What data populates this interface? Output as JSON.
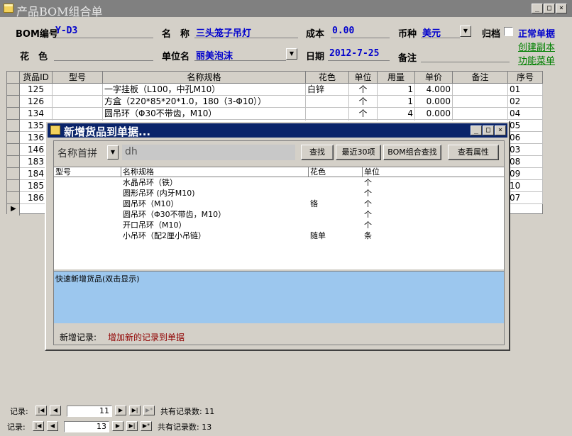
{
  "window": {
    "title": "产品BOM组合单"
  },
  "form": {
    "bom_no_label": "BOM编号",
    "bom_no": "Y-D3",
    "name_label": "名　称",
    "name": "三头笼子吊灯",
    "cost_label": "成本",
    "cost": "0.00",
    "currency_label": "币种",
    "currency": "美元",
    "archive_label": "归档",
    "status": "正常单据",
    "color_label": "花　色",
    "color": "",
    "unit_label": "单位名",
    "unit": "丽美泡沫",
    "date_label": "日期",
    "date": "2012-7-25",
    "remark_label": "备注",
    "remark": "",
    "create_copy": "创建副本",
    "function_menu": "功能菜单"
  },
  "grid": {
    "columns": [
      "货品ID",
      "型号",
      "名称规格",
      "花色",
      "单位",
      "用量",
      "单价",
      "备注",
      "序号"
    ],
    "rows": [
      {
        "id": "125",
        "model": "",
        "name": "一字挂板（L100，中孔M10）",
        "color": "白锌",
        "unit": "个",
        "qty": "1",
        "price": "4.000",
        "remark": "",
        "seq": "01"
      },
      {
        "id": "126",
        "model": "",
        "name": "方盒（220*85*20*1.0，180（3-Φ10））",
        "color": "",
        "unit": "个",
        "qty": "1",
        "price": "0.000",
        "remark": "",
        "seq": "02"
      },
      {
        "id": "134",
        "model": "",
        "name": "圆吊环（Φ30不带齿，M10）",
        "color": "",
        "unit": "个",
        "qty": "4",
        "price": "0.000",
        "remark": "",
        "seq": "04"
      },
      {
        "id": "135",
        "model": "",
        "name": "",
        "color": "",
        "unit": "",
        "qty": "",
        "price": "",
        "remark": "",
        "seq": "05"
      },
      {
        "id": "136",
        "model": "",
        "name": "",
        "color": "",
        "unit": "",
        "qty": "",
        "price": "",
        "remark": "",
        "seq": "06"
      },
      {
        "id": "146",
        "model": "",
        "name": "",
        "color": "",
        "unit": "",
        "qty": "",
        "price": "",
        "remark": "",
        "seq": "03"
      },
      {
        "id": "183",
        "model": "",
        "name": "",
        "color": "",
        "unit": "",
        "qty": "",
        "price": "",
        "remark": "",
        "seq": "08"
      },
      {
        "id": "184",
        "model": "",
        "name": "",
        "color": "",
        "unit": "",
        "qty": "",
        "price": "",
        "remark": "",
        "seq": "09"
      },
      {
        "id": "185",
        "model": "",
        "name": "",
        "color": "",
        "unit": "",
        "qty": "",
        "price": "",
        "remark": "",
        "seq": "10"
      },
      {
        "id": "186",
        "model": "",
        "name": "",
        "color": "",
        "unit": "",
        "qty": "",
        "price": "",
        "remark": "",
        "seq": "07"
      }
    ]
  },
  "dialog": {
    "title": "新增货品到单据...",
    "search_label": "名称首拼",
    "search_value": "dh",
    "btn_search": "查找",
    "btn_recent": "最近30项",
    "btn_bom": "BOM组合查找",
    "btn_props": "查看属性",
    "columns": [
      "型号",
      "名称规格",
      "花色",
      "单位"
    ],
    "products": [
      {
        "model": "",
        "name": "水晶吊环（铁）",
        "color": "",
        "unit": "个"
      },
      {
        "model": "",
        "name": "圆形吊环 (内牙M10)",
        "color": "",
        "unit": "个"
      },
      {
        "model": "",
        "name": "圆吊环（M10）",
        "color": "铬",
        "unit": "个"
      },
      {
        "model": "",
        "name": "圆吊环（Φ30不带齿，M10）",
        "color": "",
        "unit": "个"
      },
      {
        "model": "",
        "name": "开口吊环（M10）",
        "color": "",
        "unit": "个"
      },
      {
        "model": "",
        "name": "小吊环（配2厘小吊链）",
        "color": "随单",
        "unit": "条"
      }
    ],
    "quick_label": "快速新增货品(双击显示)",
    "new_record_label": "新增记录:",
    "new_record_action": "增加新的记录到单据"
  },
  "nav_inner": {
    "label": "记录:",
    "current": "11",
    "total_text": "共有记录数: 11"
  },
  "nav_outer": {
    "label": "记录:",
    "current": "13",
    "total_text": "共有记录数: 13"
  }
}
